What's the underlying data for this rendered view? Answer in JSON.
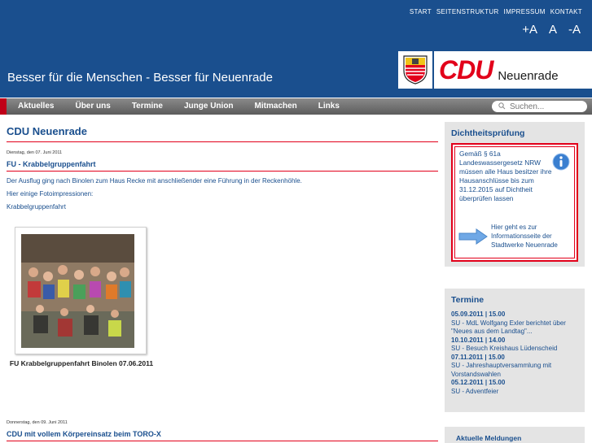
{
  "header": {
    "top_nav": [
      "START",
      "SEITENSTRUKTUR",
      "IMPRESSUM",
      "KONTAKT"
    ],
    "font_size_controls": [
      "+A",
      "A",
      "-A"
    ],
    "slogan": "Besser für die Menschen - Besser für Neuenrade",
    "logo_text": "CDU",
    "logo_city": "Neuenrade"
  },
  "menu": {
    "items": [
      "Aktuelles",
      "Über uns",
      "Termine",
      "Junge Union",
      "Mitmachen",
      "Links"
    ],
    "search_placeholder": "Suchen..."
  },
  "main": {
    "page_title": "CDU Neuenrade",
    "article1": {
      "date": "Dienstag, den 07. Juni 2011",
      "title": "FU - Krabbelgruppenfahrt",
      "paragraphs": [
        "Der Ausflug ging nach Binolen zum Haus Recke mit anschließender eine Führung in der Reckenhöhle.",
        "Hier einige Fotoimpressionen:",
        "Krabbelgruppenfahrt"
      ],
      "photo_caption": "FU Krabbelgruppenfahrt Binolen 07.06.2011"
    },
    "article2": {
      "date": "Donnerstag, den 09. Juni 2011",
      "title": "CDU mit vollem Körpereinsatz beim TORO-X"
    }
  },
  "sidebar": {
    "box1": {
      "title": "Dichtheitsprüfung",
      "text": "Gemäß § 61a Landeswassergesetz NRW müssen alle Haus besitzer ihre Hausanschlüsse bis zum 31.12.2015 auf Dichtheit überprüfen lassen",
      "link_text": "Hier geht es zur Informationsseite der Stadtwerke Neuenrade"
    },
    "box2": {
      "title": "Termine",
      "events": [
        {
          "date": "05.09.2011 | 15.00",
          "desc": "SU - MdL Wolfgang Exler berichtet über \"Neues aus dem Landtag\"..."
        },
        {
          "date": "10.10.2011 | 14.00",
          "desc": "SU - Besuch Kreishaus Lüdenscheid"
        },
        {
          "date": "07.11.2011 | 15.00",
          "desc": "SU - Jahreshauptversammlung mit Vorstandswahlen"
        },
        {
          "date": "05.12.2011 | 15.00",
          "desc": "SU - Adventfeier"
        }
      ]
    },
    "box3": {
      "title": "Aktuelle Meldungen"
    }
  },
  "colors": {
    "header_blue": "#1a4f8e",
    "cdu_red": "#e2001a",
    "sidebar_grey": "#e4e4e4"
  }
}
